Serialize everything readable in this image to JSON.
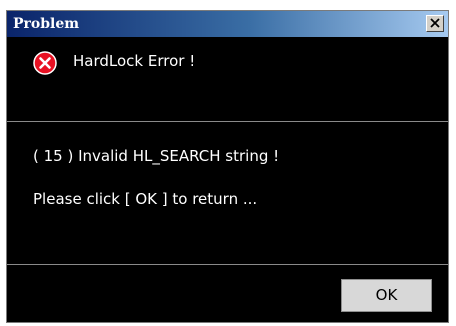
{
  "window": {
    "title": "Problem",
    "close_icon": "close-icon",
    "titlebar_gradient": [
      "#0a246a",
      "#3a6ea5",
      "#a6caf0"
    ],
    "background": "#000000"
  },
  "header": {
    "icon": "error-icon",
    "icon_color": "#e81123",
    "text": "HardLock Error !"
  },
  "body": {
    "line1": "( 15 ) Invalid HL_SEARCH string !",
    "line2": "Please click [ OK ] to return ..."
  },
  "footer": {
    "ok_label": "OK"
  }
}
